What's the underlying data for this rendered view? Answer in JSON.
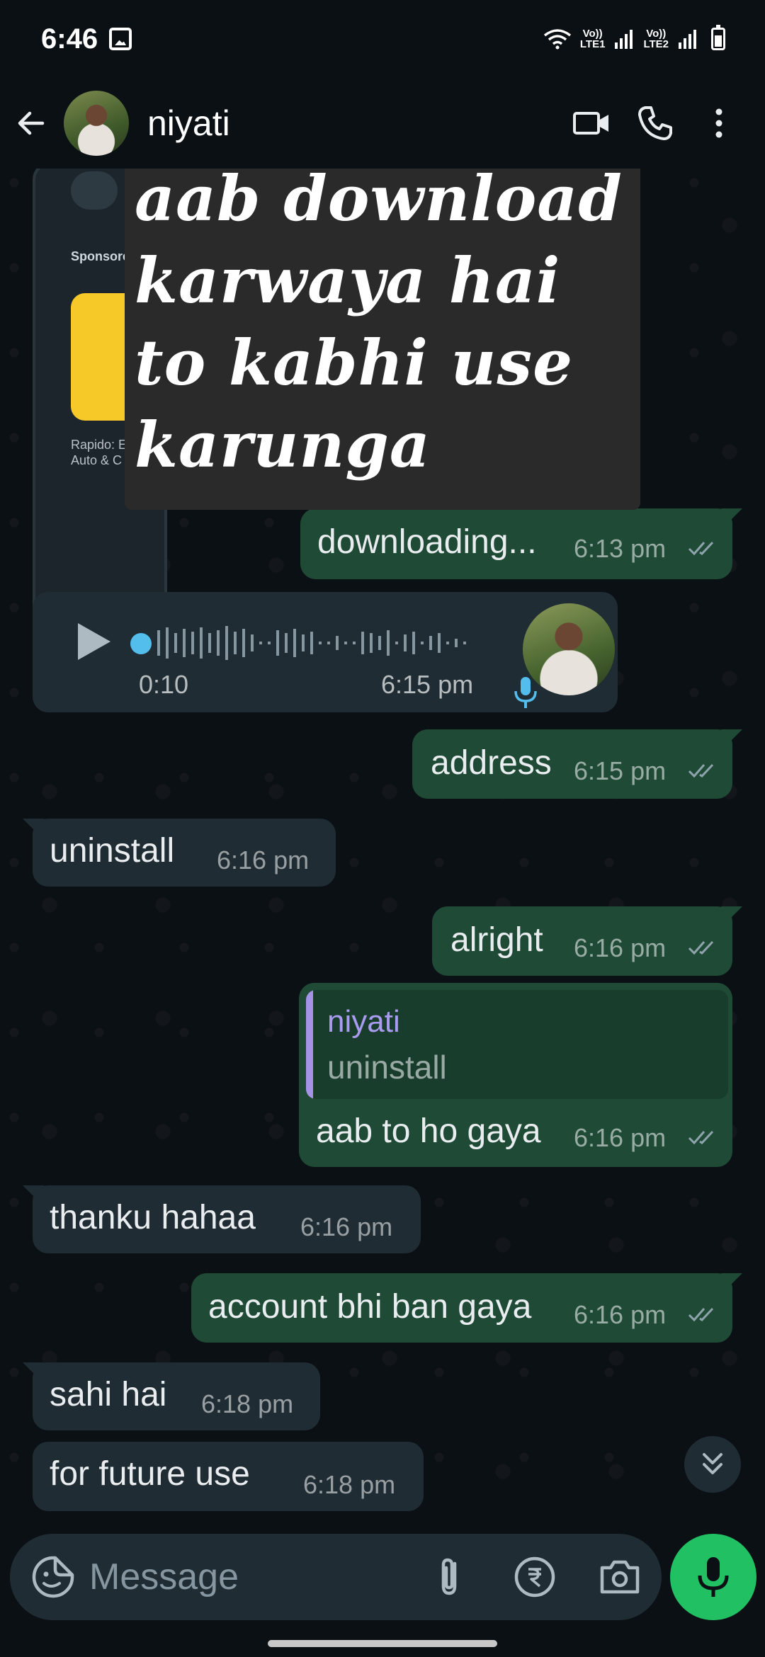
{
  "status_bar": {
    "time": "6:46",
    "sim1": "Vo))\nLTE1",
    "sim2": "Vo))\nLTE2"
  },
  "header": {
    "contact_name": "niyati",
    "icons": [
      "back-arrow-icon",
      "video-call-icon",
      "phone-icon",
      "more-vert-icon"
    ]
  },
  "sponsored": {
    "label": "Sponsore",
    "caption": "Rapido: E\nAuto & C"
  },
  "overlay_note": {
    "text": "aab download karwaya hai to kabhi use karunga"
  },
  "messages": [
    {
      "dir": "out",
      "text": "downloading...",
      "time": "6:13 pm",
      "status": "read"
    },
    {
      "dir": "in",
      "type": "voice",
      "duration": "0:10",
      "time": "6:15 pm"
    },
    {
      "dir": "out",
      "text": "address",
      "time": "6:15 pm",
      "status": "read"
    },
    {
      "dir": "in",
      "text": "uninstall",
      "time": "6:16 pm"
    },
    {
      "dir": "out",
      "text": "alright",
      "time": "6:16 pm",
      "status": "read"
    },
    {
      "dir": "out",
      "reply_to": {
        "name": "niyati",
        "text": "uninstall"
      },
      "text": "aab to ho gaya",
      "time": "6:16 pm",
      "status": "read"
    },
    {
      "dir": "in",
      "text": "thanku hahaa",
      "time": "6:16 pm"
    },
    {
      "dir": "out",
      "text": "account bhi ban gaya",
      "time": "6:16 pm",
      "status": "read"
    },
    {
      "dir": "in",
      "text": "sahi hai",
      "time": "6:18 pm"
    },
    {
      "dir": "in",
      "text": "for future use",
      "time": "6:18 pm"
    }
  ],
  "input": {
    "placeholder": "Message"
  },
  "colors": {
    "background": "#0b1014",
    "incoming_bubble": "#202c33",
    "outgoing_bubble": "#1f4b36",
    "mic_button": "#21c063",
    "reply_accent": "#a593e8",
    "voice_dot": "#53bdeb"
  }
}
